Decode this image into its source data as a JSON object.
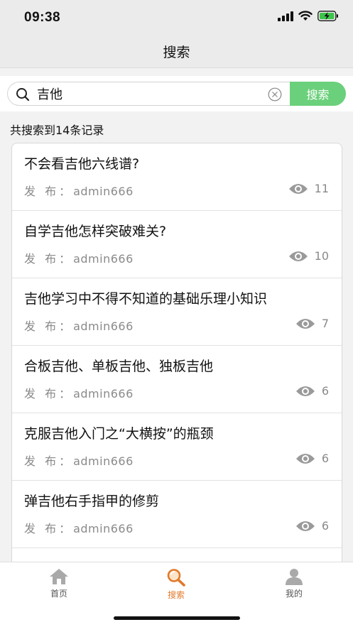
{
  "status_bar": {
    "time": "09:38"
  },
  "nav": {
    "title": "搜索"
  },
  "search": {
    "query": "吉他",
    "button_label": "搜索"
  },
  "summary": "共搜索到14条记录",
  "author_label": "发  布：",
  "results": [
    {
      "title": "不会看吉他六线谱?",
      "author": "admin666",
      "views": "11"
    },
    {
      "title": "自学吉他怎样突破难关?",
      "author": "admin666",
      "views": "10"
    },
    {
      "title": "吉他学习中不得不知道的基础乐理小知识",
      "author": "admin666",
      "views": "7"
    },
    {
      "title": "合板吉他、单板吉他、独板吉他",
      "author": "admin666",
      "views": "6"
    },
    {
      "title": "克服吉他入门之“大横按”的瓶颈",
      "author": "admin666",
      "views": "6"
    },
    {
      "title": "弹吉他右手指甲的修剪",
      "author": "admin666",
      "views": "6"
    }
  ],
  "tabs": [
    {
      "label": "首页",
      "icon": "home-icon"
    },
    {
      "label": "搜索",
      "icon": "search-icon"
    },
    {
      "label": "我的",
      "icon": "user-icon"
    }
  ],
  "colors": {
    "accent_green": "#6bd07b",
    "active_tab": "#e07a2b"
  }
}
